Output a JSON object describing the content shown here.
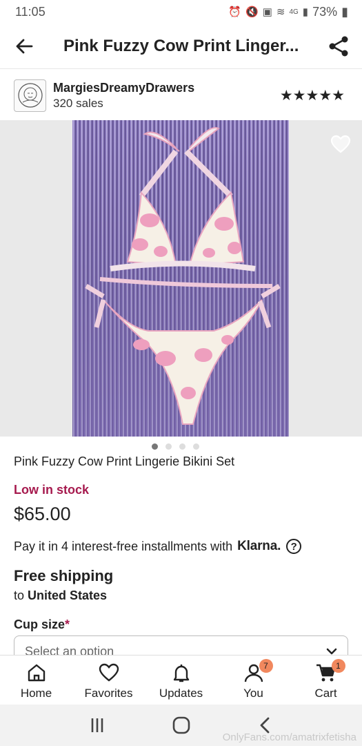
{
  "status_bar": {
    "time": "11:05",
    "network": "4G",
    "battery": "73%"
  },
  "header": {
    "title": "Pink Fuzzy Cow Print Linger..."
  },
  "shop": {
    "name": "MargiesDreamyDrawers",
    "sales": "320 sales",
    "stars": "★★★★★"
  },
  "gallery": {
    "image_count": 4,
    "active_index": 0
  },
  "product": {
    "name": "Pink Fuzzy Cow Print Lingerie Bikini Set",
    "stock": "Low in stock",
    "price": "$65.00",
    "klarna_text": "Pay it in 4 interest-free installments with",
    "klarna_logo": "Klarna.",
    "help_glyph": "?"
  },
  "shipping": {
    "title": "Free shipping",
    "prefix": "to",
    "destination": "United States"
  },
  "variation": {
    "label": "Cup size",
    "required_mark": "*",
    "placeholder": "Select an option"
  },
  "bottom_nav": [
    {
      "label": "Home",
      "icon": "home-icon"
    },
    {
      "label": "Favorites",
      "icon": "heart-icon"
    },
    {
      "label": "Updates",
      "icon": "bell-icon"
    },
    {
      "label": "You",
      "icon": "user-icon",
      "badge": "7"
    },
    {
      "label": "Cart",
      "icon": "cart-icon",
      "badge": "1"
    }
  ],
  "watermark": "OnlyFans.com/amatrixfetisha",
  "colors": {
    "accent_stock": "#a61a4e",
    "badge": "#f1885e",
    "text": "#222222"
  }
}
